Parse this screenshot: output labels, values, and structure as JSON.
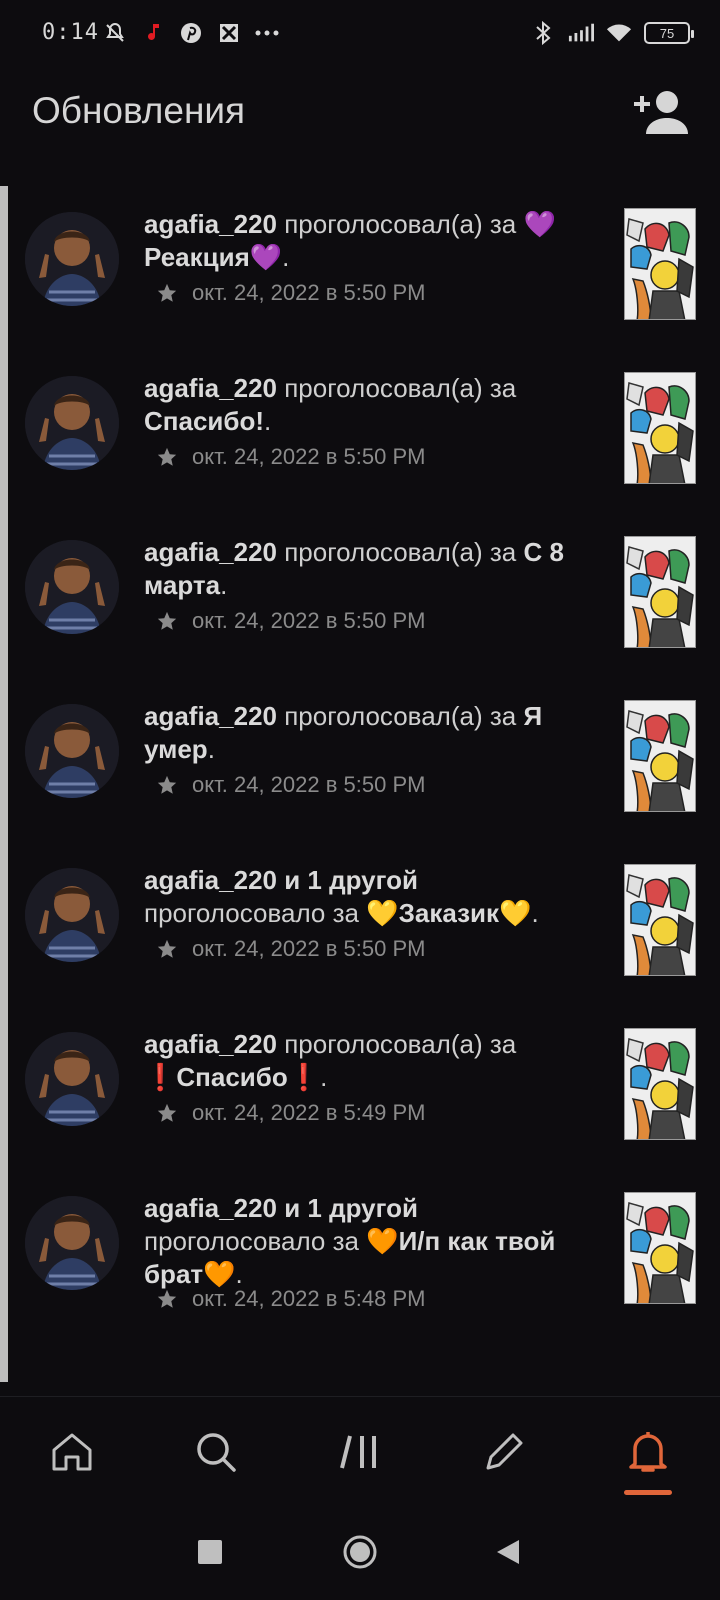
{
  "status_bar": {
    "time": "0:14",
    "left_icons": [
      "mute-icon",
      "music-note-icon",
      "pinterest-icon",
      "app-icon",
      "more-dots-icon"
    ],
    "right_icons": [
      "bluetooth-icon",
      "signal-icon",
      "wifi-icon"
    ],
    "battery": "75"
  },
  "header": {
    "title": "Обновления",
    "action_icon": "add-user-icon"
  },
  "notifications": [
    {
      "user": "agafia_220",
      "action": " проголосовал(а) за ",
      "target": "💜Реакция💜",
      "suffix": ".",
      "time": "окт. 24, 2022 в 5:50 PM"
    },
    {
      "user": "agafia_220",
      "action": " проголосовал(а) за ",
      "target": "Спасибо!",
      "suffix": ".",
      "time": "окт. 24, 2022 в 5:50 PM"
    },
    {
      "user": "agafia_220",
      "action": " проголосовал(а) за ",
      "target": "С 8 марта",
      "suffix": ".",
      "time": "окт. 24, 2022 в 5:50 PM"
    },
    {
      "user": "agafia_220",
      "action": " проголосовал(а) за ",
      "target": "Я умер",
      "suffix": ".",
      "time": "окт. 24, 2022 в 5:50 PM"
    },
    {
      "user": "agafia_220 и 1 другой",
      "action": " проголосовало за ",
      "target": "💛Заказик💛",
      "suffix": ".",
      "time": "окт. 24, 2022 в 5:50 PM"
    },
    {
      "user": "agafia_220",
      "action": " проголосовал(а) за ",
      "target": "❗Спасибо❗",
      "suffix": ".",
      "time": "окт. 24, 2022 в 5:49 PM"
    },
    {
      "user": "agafia_220 и 1 другой",
      "action": " проголосовало за ",
      "target": "🧡И/п как твой брат🧡",
      "suffix": ".",
      "time": "окт. 24, 2022 в 5:48 PM"
    }
  ],
  "bottom_nav": {
    "items": [
      "home-icon",
      "search-icon",
      "library-icon",
      "compose-icon",
      "notifications-bell-icon"
    ],
    "active": "notifications-bell-icon",
    "accent_color": "#e0663a"
  },
  "system_nav": [
    "recents-square-icon",
    "home-circle-icon",
    "back-triangle-icon"
  ]
}
